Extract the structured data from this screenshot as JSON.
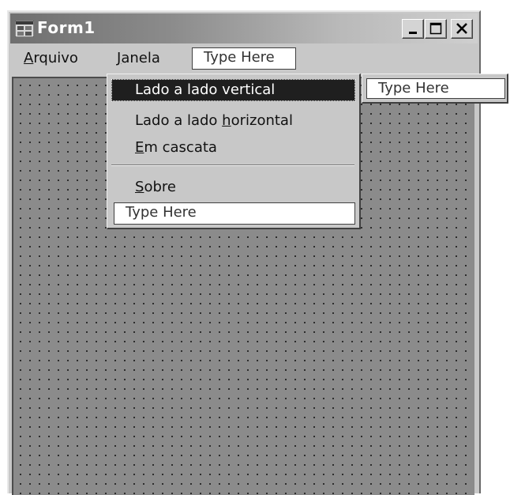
{
  "window": {
    "title": "Form1",
    "caption_buttons": [
      "minimize-icon",
      "maximize-icon",
      "close-icon"
    ]
  },
  "menubar": {
    "items": [
      {
        "label_first": "A",
        "label_rest": "rquivo"
      },
      {
        "label_first": "J",
        "label_rest": "anela"
      }
    ],
    "type_here": "Type Here"
  },
  "janela_menu": {
    "items": [
      {
        "pre": "Lado a lado vertical",
        "mn": "",
        "post": "",
        "selected": true
      },
      {
        "pre": "Lado a lado ",
        "mn": "h",
        "post": "orizontal",
        "selected": false
      },
      {
        "pre": "",
        "mn": "E",
        "post": "m cascata",
        "selected": false
      },
      {
        "pre": "",
        "mn": "S",
        "post": "obre",
        "selected": false
      }
    ],
    "type_here": "Type Here",
    "submenu_type_here": "Type Here"
  },
  "colors": {
    "title_gradient_start": "#6f6f6f",
    "title_gradient_end": "#cfcfcf",
    "chrome": "#c8c8c8",
    "mdi_client": "#8b8b8b",
    "selection": "#1f1f1f"
  }
}
